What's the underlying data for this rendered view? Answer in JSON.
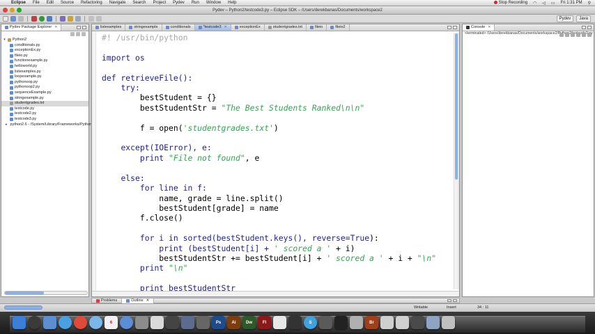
{
  "menubar": {
    "app": "Eclipse",
    "items": [
      "File",
      "Edit",
      "Source",
      "Refactoring",
      "Navigate",
      "Search",
      "Project",
      "Pydev",
      "Run",
      "Window",
      "Help"
    ],
    "recording": "Stop Recording",
    "clock": "Fri 1:31 PM"
  },
  "window": {
    "title": "Pydev – Python2/testcode3.py – Eclipse SDK – /Users/derekbanas/Documents/workspace2"
  },
  "perspectives": [
    "Pydev",
    "Java"
  ],
  "explorer": {
    "tab_label": "Pydev Package Explorer",
    "project": "Python2",
    "files": [
      "conditionals.py",
      "exceptionEx.py",
      "fileio.py",
      "functionexample.py",
      "helloworld.py",
      "listexamples.py",
      "loopexample.py",
      "pythonoop.py",
      "pythonoop2.py",
      "sequenceExample.py",
      "stringexample.py",
      "studentgrades.txt",
      "testcode.py",
      "testcode2.py",
      "testcode3.py"
    ],
    "selected": "studentgrades.txt",
    "library": "python2.6 - /System/Library/Frameworks/Python.framework"
  },
  "editor": {
    "tabs": [
      "listexamples",
      "stringexample",
      "conditionals",
      "*testcode3",
      "exceptionEx",
      "studentgrades.txt",
      "fileio",
      "fileio2"
    ],
    "active_tab": "*testcode3",
    "code": {
      "l1": "#! /usr/bin/python",
      "l2": "import os",
      "l3": "def retrieveFile():",
      "l4": "try:",
      "l5": "bestStudent = {}",
      "l6": "bestStudentStr = ",
      "l6s": "\"The Best Students Ranked\\n\\n\"",
      "l7": "f = open(",
      "l7s": "'studentgrades.txt'",
      "l7e": ")",
      "l8": "except(IOError), e:",
      "l9": "print ",
      "l9s": "\"File not found\"",
      "l9e": ", e",
      "l10": "else:",
      "l11": "for line in f:",
      "l12": "name, grade = line.split()",
      "l13": "bestStudent[grade] = name",
      "l14": "f.close()",
      "l15a": "for i in sorted(bestStudent.keys(), reverse=",
      "l15b": "True",
      "l15c": "):",
      "l16a": "print (bestStudent[i] + ",
      "l16s": "' scored a '",
      "l16b": " + i)",
      "l17a": "bestStudentStr += bestStudent[i] + ",
      "l17s": "' scored a '",
      "l17b": " + i + ",
      "l17n": "\"\\n\"",
      "l18a": "print ",
      "l18s": "\"\\n\"",
      "l19": "print bestStudentStr"
    }
  },
  "console": {
    "tab_label": "Console",
    "line": "<terminated> /Users/derekbanas/Documents/workspace2/Python2/testcode3.py"
  },
  "bottom_tabs": [
    "Problems",
    "Outline"
  ],
  "status": {
    "writable": "Writable",
    "insert": "Insert",
    "position": "34 : 11"
  },
  "dock": [
    "Finder",
    "Dashboard",
    "Mail",
    "Safari",
    "Chrome",
    "iChat",
    "iCal",
    "iTunes",
    "Photos",
    "Preview",
    "Terminal",
    "Photoshop",
    "Illustrator",
    "Dreamweaver",
    "Flash",
    "Acrobat",
    "Camtasia",
    "Skype",
    "Eclipse"
  ]
}
